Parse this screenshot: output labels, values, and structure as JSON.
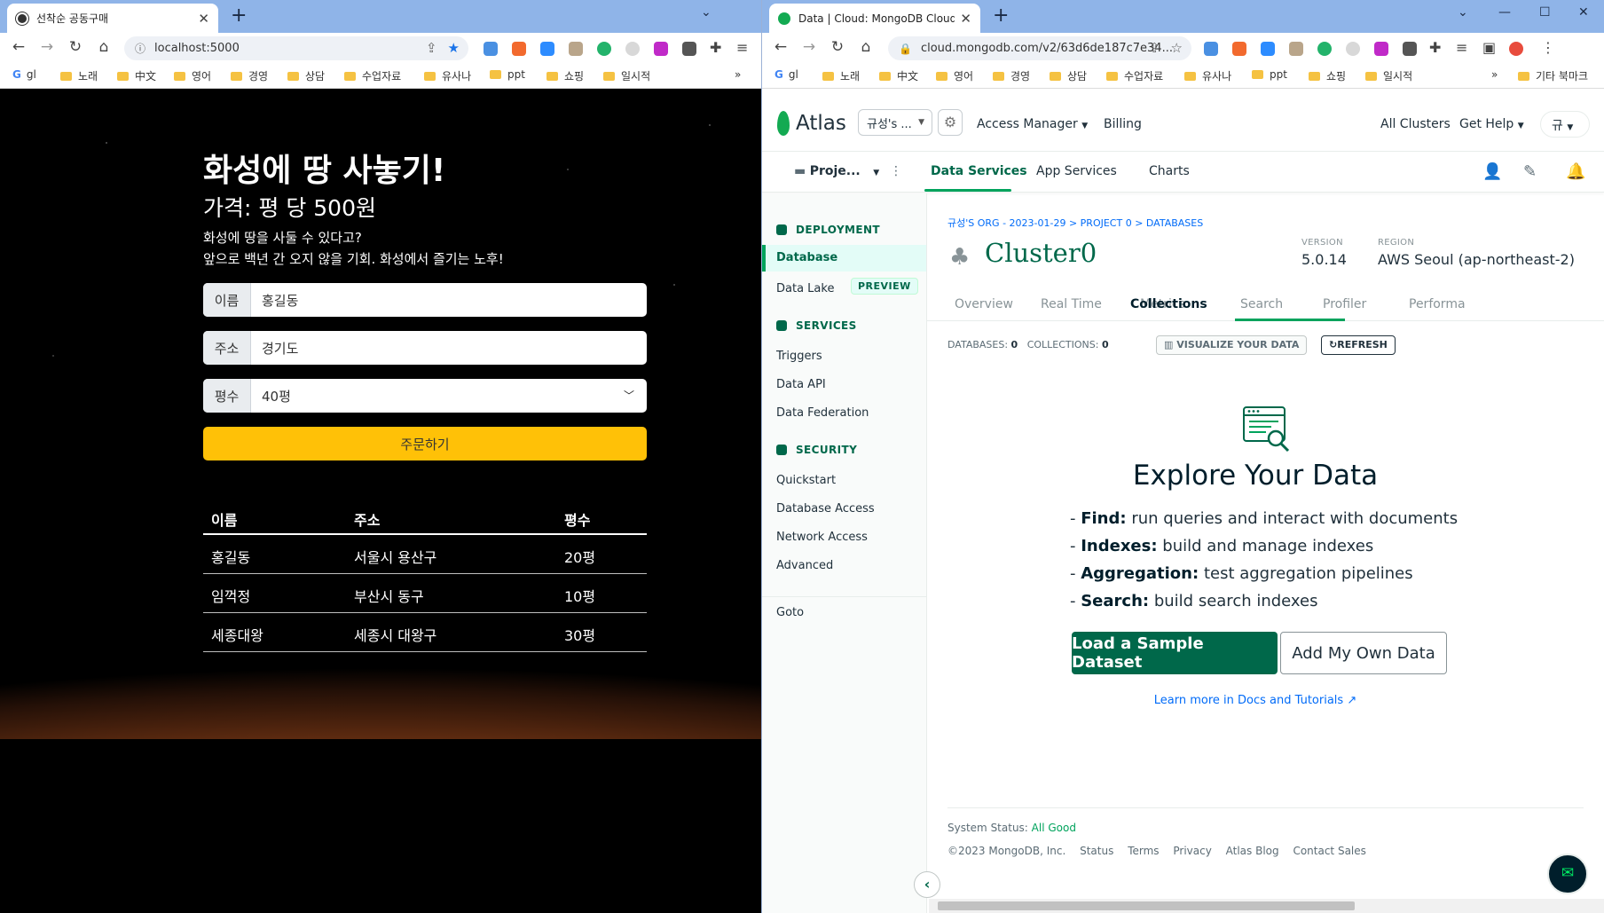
{
  "left_browser": {
    "tab_title": "선착순 공동구매",
    "url": "localhost:5000",
    "bookmarks": [
      "gl",
      "노래",
      "中文",
      "영어",
      "경영",
      "상담",
      "수업자료",
      "유사나",
      "ppt",
      "쇼핑",
      "일시적"
    ]
  },
  "mars": {
    "title": "화성에 땅 사놓기!",
    "price": "가격: 평 당 500원",
    "desc1": "화성에 땅을 사둘 수 있다고?",
    "desc2": "앞으로 백년 간 오지 않을 기회. 화성에서 즐기는 노후!",
    "name_label": "이름",
    "name_placeholder": "홍길동",
    "addr_label": "주소",
    "addr_placeholder": "경기도",
    "size_label": "평수",
    "size_value": "40평",
    "order_button": "주문하기",
    "table": {
      "headers": [
        "이름",
        "주소",
        "평수"
      ],
      "rows": [
        [
          "홍길동",
          "서울시 용산구",
          "20평"
        ],
        [
          "임꺽정",
          "부산시 동구",
          "10평"
        ],
        [
          "세종대왕",
          "세종시 대왕구",
          "30평"
        ]
      ]
    }
  },
  "right_browser": {
    "tab_title": "Data | Cloud: MongoDB Cloud",
    "url": "cloud.mongodb.com/v2/63d6de187c7e34...",
    "bookmarks": [
      "gl",
      "노래",
      "中文",
      "영어",
      "경영",
      "상담",
      "수업자료",
      "유사나",
      "ppt",
      "쇼핑",
      "일시적"
    ],
    "other_bookmarks": "기타 북마크"
  },
  "atlas": {
    "logo": "Atlas",
    "org": "규성's ...",
    "top_nav": [
      "Access Manager",
      "Billing"
    ],
    "right_nav": [
      "All Clusters",
      "Get Help"
    ],
    "user_initial": "규",
    "project": "Proje...",
    "sub_nav": [
      "Data Services",
      "App Services",
      "Charts"
    ],
    "sidebar": {
      "deployment": "DEPLOYMENT",
      "database": "Database",
      "data_lake": "Data Lake",
      "preview": "PREVIEW",
      "services": "SERVICES",
      "triggers": "Triggers",
      "data_api": "Data API",
      "data_federation": "Data Federation",
      "security": "SECURITY",
      "quickstart": "Quickstart",
      "database_access": "Database Access",
      "network_access": "Network Access",
      "advanced": "Advanced",
      "goto": "Goto"
    },
    "breadcrumb": "규성'S ORG - 2023-01-29 > PROJECT 0 > DATABASES",
    "cluster_name": "Cluster0",
    "version_label": "VERSION",
    "version": "5.0.14",
    "region_label": "REGION",
    "region": "AWS Seoul (ap-northeast-2)",
    "tabs": [
      "Overview",
      "Real Time",
      "Metrics",
      "Collections",
      "Search",
      "Profiler",
      "Performa"
    ],
    "databases_label": "DATABASES:",
    "databases_count": "0",
    "collections_label": "COLLECTIONS:",
    "collections_count": "0",
    "visualize_button": "VISUALIZE YOUR DATA",
    "refresh_button": "REFRESH",
    "explore_title": "Explore Your Data",
    "features": [
      {
        "key": "Find:",
        "text": "run queries and interact with documents"
      },
      {
        "key": "Indexes:",
        "text": "build and manage indexes"
      },
      {
        "key": "Aggregation:",
        "text": "test aggregation pipelines"
      },
      {
        "key": "Search:",
        "text": "build search indexes"
      }
    ],
    "load_button": "Load a Sample Dataset",
    "own_button": "Add My Own Data",
    "learn_link": "Learn more in Docs and Tutorials",
    "status_label": "System Status:",
    "status_value": "All Good",
    "footer": [
      "©2023 MongoDB, Inc.",
      "Status",
      "Terms",
      "Privacy",
      "Atlas Blog",
      "Contact Sales"
    ]
  }
}
